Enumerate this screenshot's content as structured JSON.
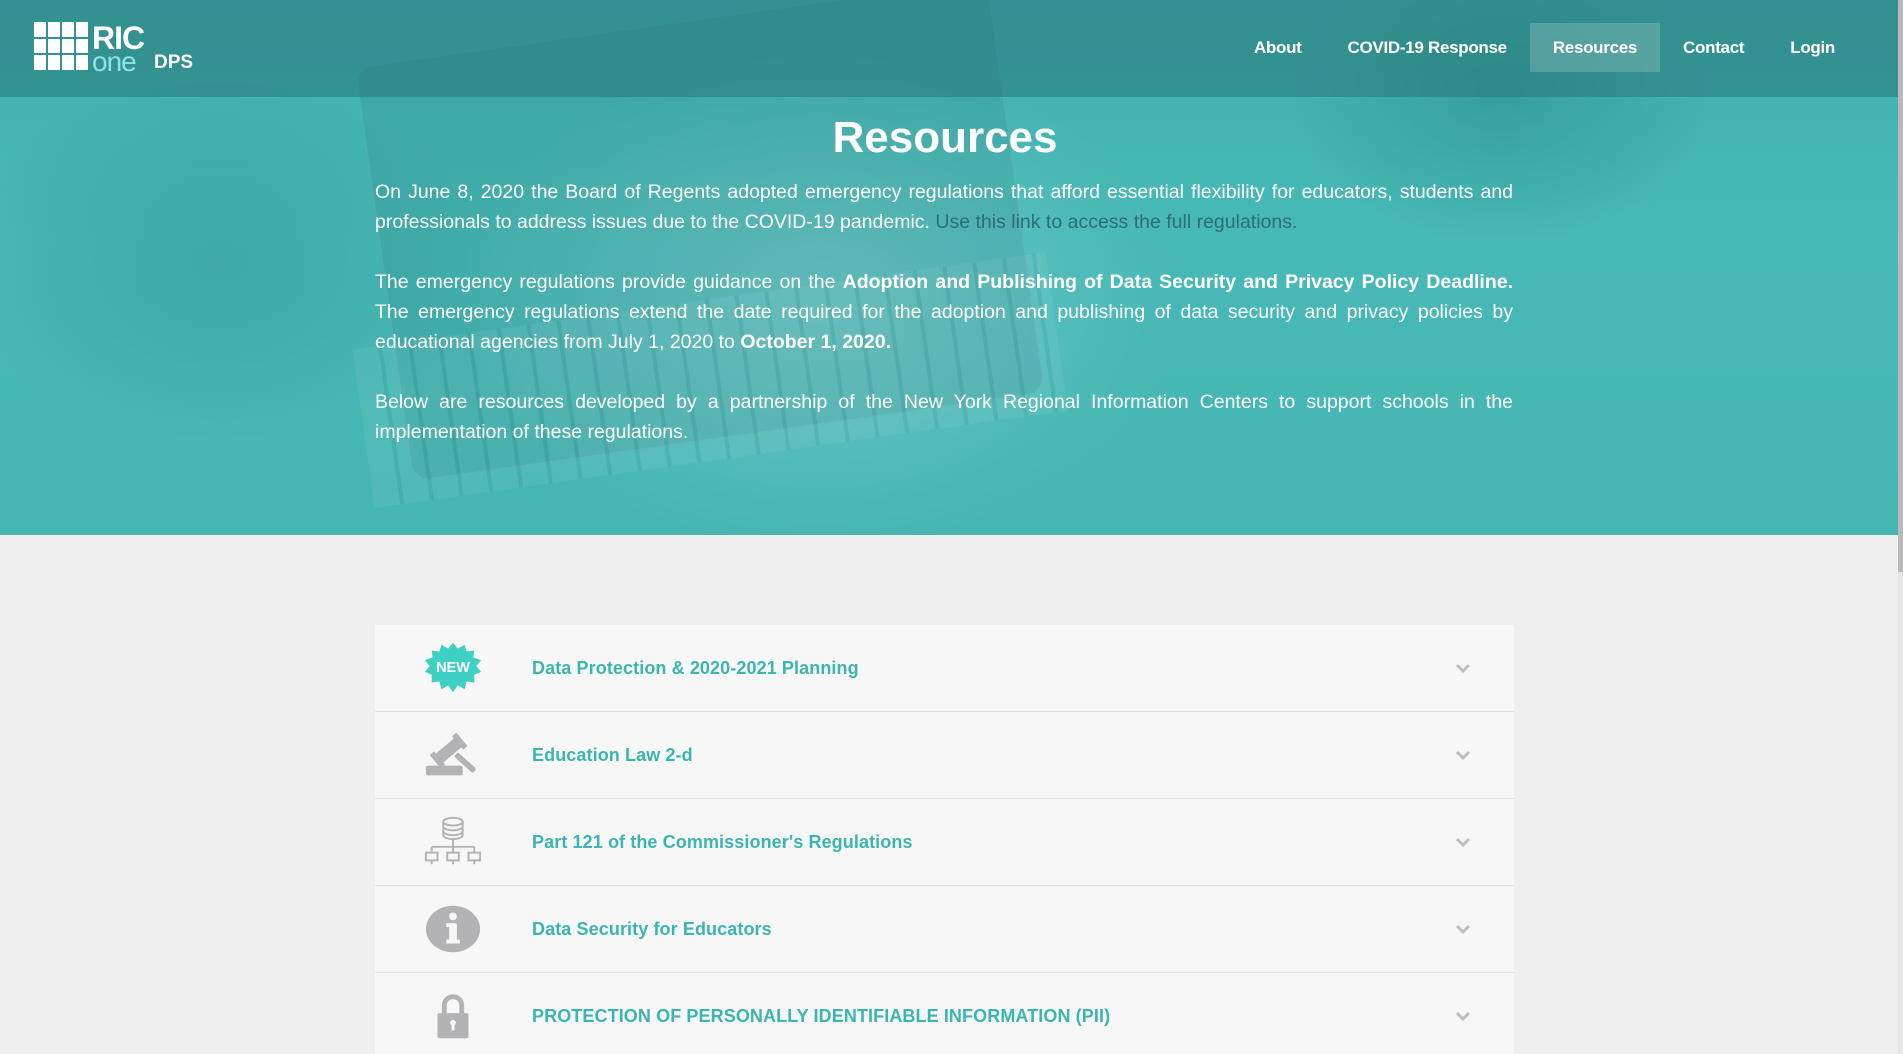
{
  "brand": {
    "logo_ric": "RIC",
    "logo_one": "one",
    "logo_dps": "DPS"
  },
  "nav": {
    "items": [
      {
        "label": "About"
      },
      {
        "label": "COVID-19 Response"
      },
      {
        "label": "Resources",
        "active": true
      },
      {
        "label": "Contact"
      },
      {
        "label": "Login"
      }
    ]
  },
  "hero": {
    "title": "Resources",
    "p1_text": "On June 8, 2020 the Board of Regents adopted emergency regulations that afford essential flexibility for educators, students and professionals to address issues due to the COVID-19 pandemic.",
    "p1_link": "Use this link to access the full regulations.",
    "p2_a": "The emergency regulations provide guidance on the",
    "p2_bold": "Adoption and Publishing of Data Security and Privacy Policy Deadline.",
    "p2_b": "The emergency regulations extend the date required for the adoption and publishing of data security and privacy policies by educational agencies from July 1, 2020 to",
    "p2_date": "October 1, 2020.",
    "p3": "Below are resources developed by a partnership of the New York Regional Information Centers to support schools in the implementation of these regulations."
  },
  "accordion": {
    "items": [
      {
        "title": "Data Protection & 2020-2021 Planning",
        "icon": "new-badge-icon",
        "badge_text": "NEW"
      },
      {
        "title": "Education Law 2-d",
        "icon": "gavel-icon"
      },
      {
        "title": "Part 121 of the Commissioner's Regulations",
        "icon": "network-database-icon"
      },
      {
        "title": "Data Security for Educators",
        "icon": "info-icon"
      },
      {
        "title": "PROTECTION OF PERSONALLY IDENTIFIABLE INFORMATION (PII)",
        "icon": "lock-icon"
      }
    ]
  },
  "colors": {
    "accent": "#3bb5b0",
    "hero_bg": "#46b6b3",
    "icon_gray": "#b3b3b5",
    "link": "#2c6f71"
  }
}
